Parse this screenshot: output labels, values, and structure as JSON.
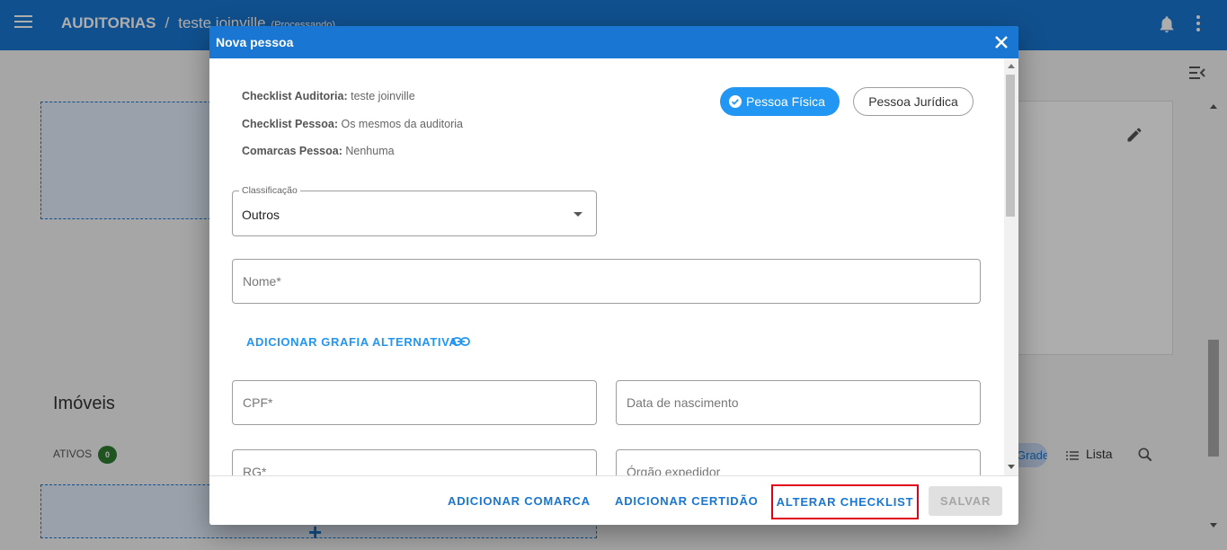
{
  "app": {
    "section": "AUDITORIAS",
    "separator": "/",
    "project": "teste joinville",
    "status": "(Processando)"
  },
  "background": {
    "section_title": "Imóveis",
    "ativos_label": "ATIVOS",
    "ativos_count": "0",
    "view_grid_label": "Grade",
    "view_list_label": "Lista"
  },
  "dialog": {
    "title": "Nova pessoa",
    "info": [
      {
        "label": "Checklist Auditoria:",
        "value": "teste joinville"
      },
      {
        "label": "Checklist Pessoa:",
        "value": "Os mesmos da auditoria"
      },
      {
        "label": "Comarcas Pessoa:",
        "value": "Nenhuma"
      }
    ],
    "person_type": {
      "fisica": "Pessoa Física",
      "juridica": "Pessoa Jurídica",
      "selected": "fisica"
    },
    "fields": {
      "classificacao_label": "Classificação",
      "classificacao_value": "Outros",
      "nome_placeholder": "Nome*",
      "cpf_placeholder": "CPF*",
      "nascimento_placeholder": "Data de nascimento",
      "rg_placeholder": "RG*",
      "orgao_placeholder": "Órgão expedidor"
    },
    "add_alt_spelling": "ADICIONAR GRAFIA ALTERNATIVA",
    "footer": {
      "add_comarca": "ADICIONAR COMARCA",
      "add_certidao": "ADICIONAR CERTIDÃO",
      "alter_checklist": "ALTERAR CHECKLIST",
      "save": "SALVAR"
    }
  },
  "colors": {
    "primary": "#1976d2",
    "chip_selected": "#2196f3",
    "highlight": "#e0001b",
    "badge": "#2e7d32"
  }
}
